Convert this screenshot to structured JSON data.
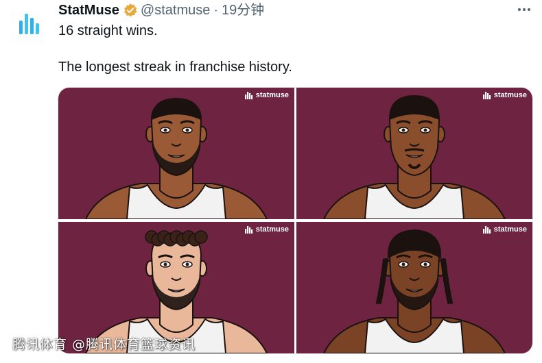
{
  "tweet": {
    "author_name": "StatMuse",
    "handle": "@statmuse",
    "separator": "·",
    "time": "19分钟",
    "line1": "16 straight wins.",
    "line2": "The longest streak in franchise history."
  },
  "media": {
    "brand_label": "statmuse",
    "background_color": "#6e2440",
    "images": [
      {
        "skin": "#9a5a36",
        "hair": "short-buzz",
        "beard": "full"
      },
      {
        "skin": "#8a4e2c",
        "hair": "short-top",
        "beard": "mustache-goatee"
      },
      {
        "skin": "#e9b89a",
        "hair": "curly-top",
        "beard": "full"
      },
      {
        "skin": "#7a4325",
        "hair": "braids",
        "beard": "full"
      }
    ]
  },
  "watermark": "腾讯体育 @腾讯体育篮球资讯",
  "colors": {
    "accent_verified": "#e8a83e",
    "text_primary": "#0f1419",
    "text_secondary": "#536471"
  }
}
